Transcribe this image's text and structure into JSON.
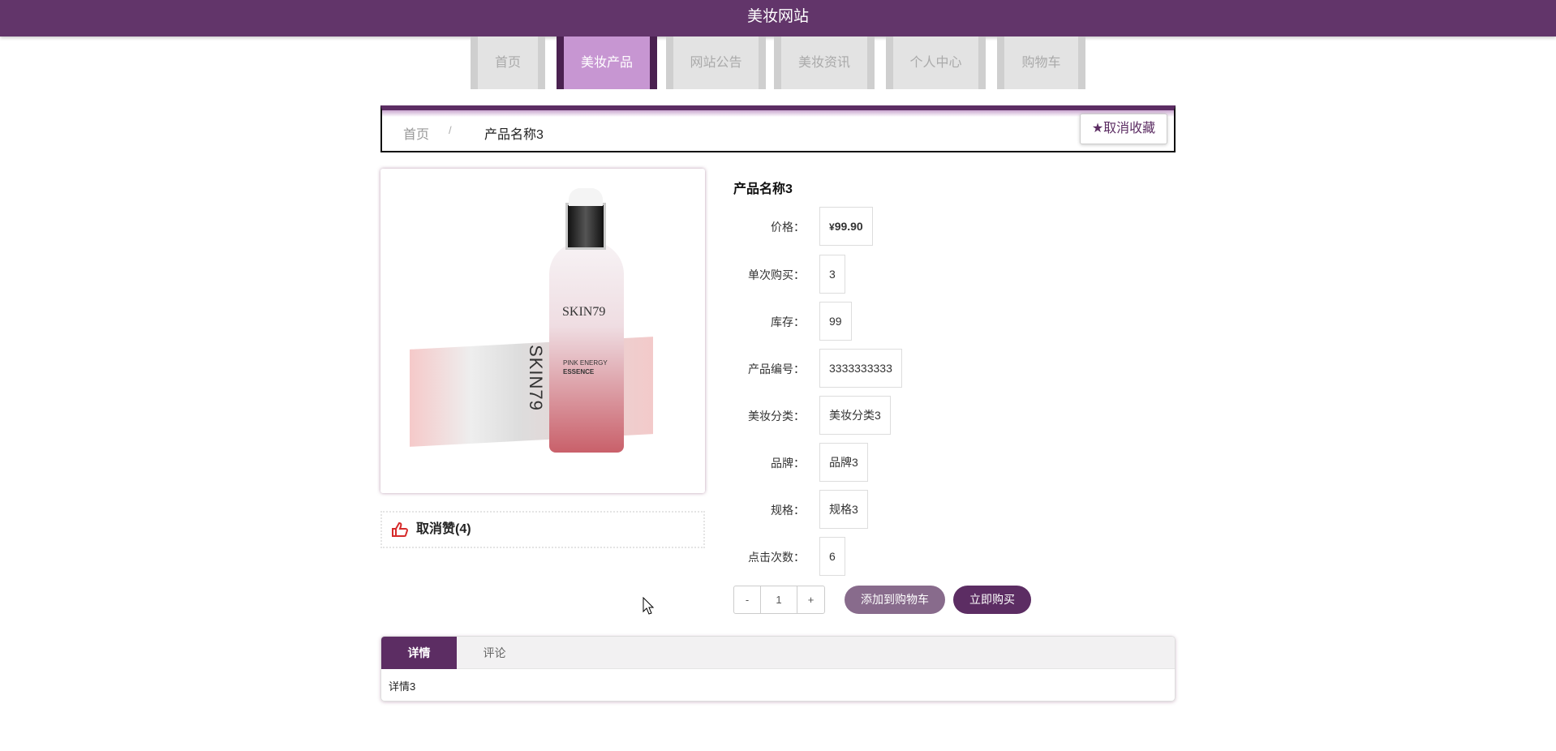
{
  "header": {
    "title": "美妆网站"
  },
  "nav": {
    "items": [
      {
        "label": "首页",
        "active": false
      },
      {
        "label": "美妆产品",
        "active": true
      },
      {
        "label": "网站公告",
        "active": false
      },
      {
        "label": "美妆资讯",
        "active": false
      },
      {
        "label": "个人中心",
        "active": false
      },
      {
        "label": "购物车",
        "active": false
      }
    ]
  },
  "breadcrumb": {
    "home": "首页",
    "separator": "/",
    "current": "产品名称3",
    "favorite_label": "取消收藏",
    "favorite_icon": "star-icon"
  },
  "product": {
    "name": "产品名称3",
    "image_text": {
      "brand": "SKIN79",
      "line1": "PINK ENERGY",
      "line2": "ESSENCE"
    },
    "like_label": "取消赞(4)",
    "like_icon": "thumbs-up-icon",
    "price_symbol": "¥",
    "price": "99.90",
    "fields": [
      {
        "label": "单次购买：",
        "value": "3"
      },
      {
        "label": "库存：",
        "value": "99"
      },
      {
        "label": "产品编号：",
        "value": "3333333333"
      },
      {
        "label": "美妆分类：",
        "value": "美妆分类3"
      },
      {
        "label": "品牌：",
        "value": "品牌3"
      },
      {
        "label": "规格：",
        "value": "规格3"
      },
      {
        "label": "点击次数：",
        "value": "6"
      }
    ],
    "price_label": "价格："
  },
  "cart": {
    "minus": "-",
    "quantity": "1",
    "plus": "+",
    "add_to_cart": "添加到购物车",
    "buy_now": "立即购买"
  },
  "detail": {
    "tabs": [
      {
        "label": "详情",
        "active": true
      },
      {
        "label": "评论",
        "active": false
      }
    ],
    "content": "详情3"
  },
  "colors": {
    "primary": "#62356a",
    "nav_active": "#c796d2",
    "price": "#c31b1b",
    "add_cart": "#886b8c"
  }
}
